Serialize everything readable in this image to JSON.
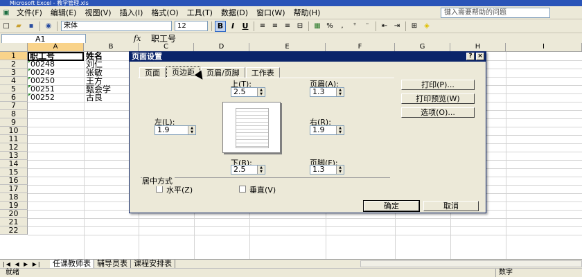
{
  "window": {
    "title": "Microsoft Excel - 教学管理.xls"
  },
  "menu": {
    "items": [
      "文件(F)",
      "编辑(E)",
      "视图(V)",
      "插入(I)",
      "格式(O)",
      "工具(T)",
      "数据(D)",
      "窗口(W)",
      "帮助(H)"
    ],
    "help_placeholder": "键入需要帮助的问题"
  },
  "toolbar": {
    "font_name": "宋体",
    "font_size": "12",
    "bold": "B",
    "italic": "I",
    "underline": "U",
    "percent": "%",
    "comma": ","
  },
  "formula": {
    "namebox": "A1",
    "fx": "fx",
    "value": "职工号"
  },
  "grid": {
    "columns": [
      "A",
      "B",
      "C",
      "D",
      "E",
      "F",
      "G",
      "H",
      "I"
    ],
    "rows": [
      "1",
      "2",
      "3",
      "4",
      "5",
      "6",
      "7",
      "8",
      "9",
      "10",
      "11",
      "12",
      "13",
      "14",
      "15",
      "16",
      "17",
      "18",
      "19",
      "20",
      "21",
      "22"
    ],
    "data": [
      [
        "职工号",
        "姓名"
      ],
      [
        "00248",
        "刘仁"
      ],
      [
        "00249",
        "张敏"
      ],
      [
        "00250",
        "王方"
      ],
      [
        "00251",
        "甄会学"
      ],
      [
        "00252",
        "古良"
      ]
    ]
  },
  "sheets": {
    "tabs": [
      "任课教师表",
      "辅导员表",
      "课程安排表"
    ]
  },
  "status": {
    "left": "就绪",
    "right": "数字"
  },
  "dialog": {
    "title": "页面设置",
    "help": "?",
    "close": "×",
    "tabs": [
      "页面",
      "页边距",
      "页眉/页脚",
      "工作表"
    ],
    "top_label": "上(T):",
    "top_value": "2.5",
    "header_label": "页眉(A):",
    "header_value": "1.3",
    "left_label": "左(L):",
    "left_value": "1.9",
    "right_label": "右(R):",
    "right_value": "1.9",
    "bottom_label": "下(B):",
    "bottom_value": "2.5",
    "footer_label": "页脚(F):",
    "footer_value": "1.3",
    "center_section": "居中方式",
    "horizontal": "水平(Z)",
    "vertical": "垂直(V)",
    "print_btn": "打印(P)...",
    "preview_btn": "打印预览(W)",
    "options_btn": "选项(O)...",
    "ok_btn": "确定",
    "cancel_btn": "取消"
  }
}
